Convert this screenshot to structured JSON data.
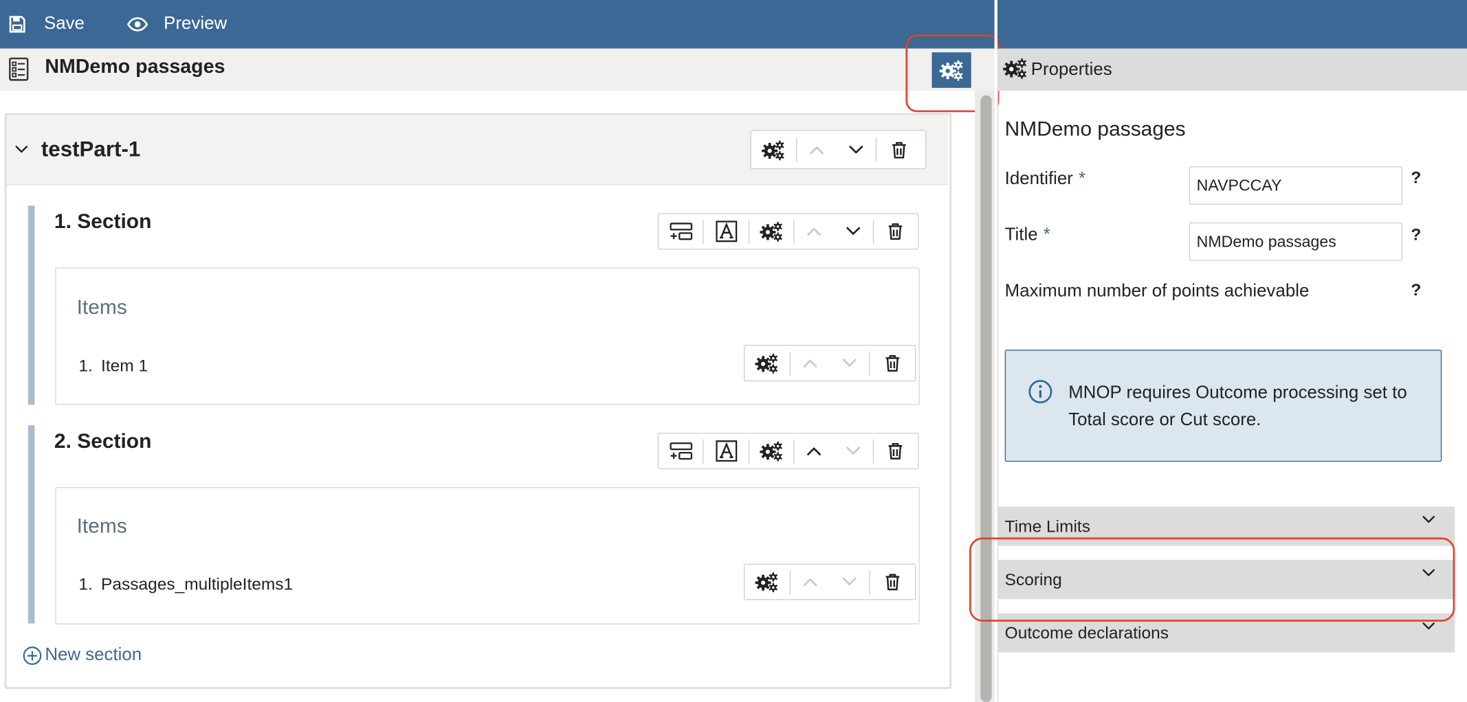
{
  "toolbar": {
    "save_label": "Save",
    "preview_label": "Preview"
  },
  "header": {
    "title": "NMDemo passages"
  },
  "properties_panel": {
    "label": "Properties",
    "title": "NMDemo passages",
    "fields": {
      "identifier": {
        "label": "Identifier",
        "required_mark": "*",
        "value": "NAVPCCAY",
        "help": "?"
      },
      "title": {
        "label": "Title",
        "required_mark": "*",
        "value": "NMDemo passages",
        "help": "?"
      },
      "max_points": {
        "label": "Maximum number of points achievable",
        "help": "?"
      }
    },
    "info_message": "MNOP requires Outcome processing set to Total score or Cut score.",
    "accordions": [
      "Time Limits",
      "Scoring",
      "Outcome declarations"
    ]
  },
  "test_part": {
    "title": "testPart-1",
    "sections": [
      {
        "title": "1. Section",
        "items_label": "Items",
        "items": [
          {
            "number": "1.",
            "label": "Item 1"
          }
        ]
      },
      {
        "title": "2. Section",
        "items_label": "Items",
        "items": [
          {
            "number": "1.",
            "label": "Passages_multipleItems1"
          }
        ]
      }
    ],
    "new_section_label": "New section"
  },
  "colors": {
    "brand": "#3b6894",
    "highlight": "#e0442a",
    "info_bg": "#dbe6ef",
    "section_bar": "#a8bccb"
  },
  "icons": [
    "save-icon",
    "eye-icon",
    "document-list-icon",
    "gears-icon",
    "chevron-up-icon",
    "chevron-down-icon",
    "trash-icon",
    "add-item-icon",
    "text-format-icon",
    "info-icon",
    "plus-circle-icon"
  ]
}
